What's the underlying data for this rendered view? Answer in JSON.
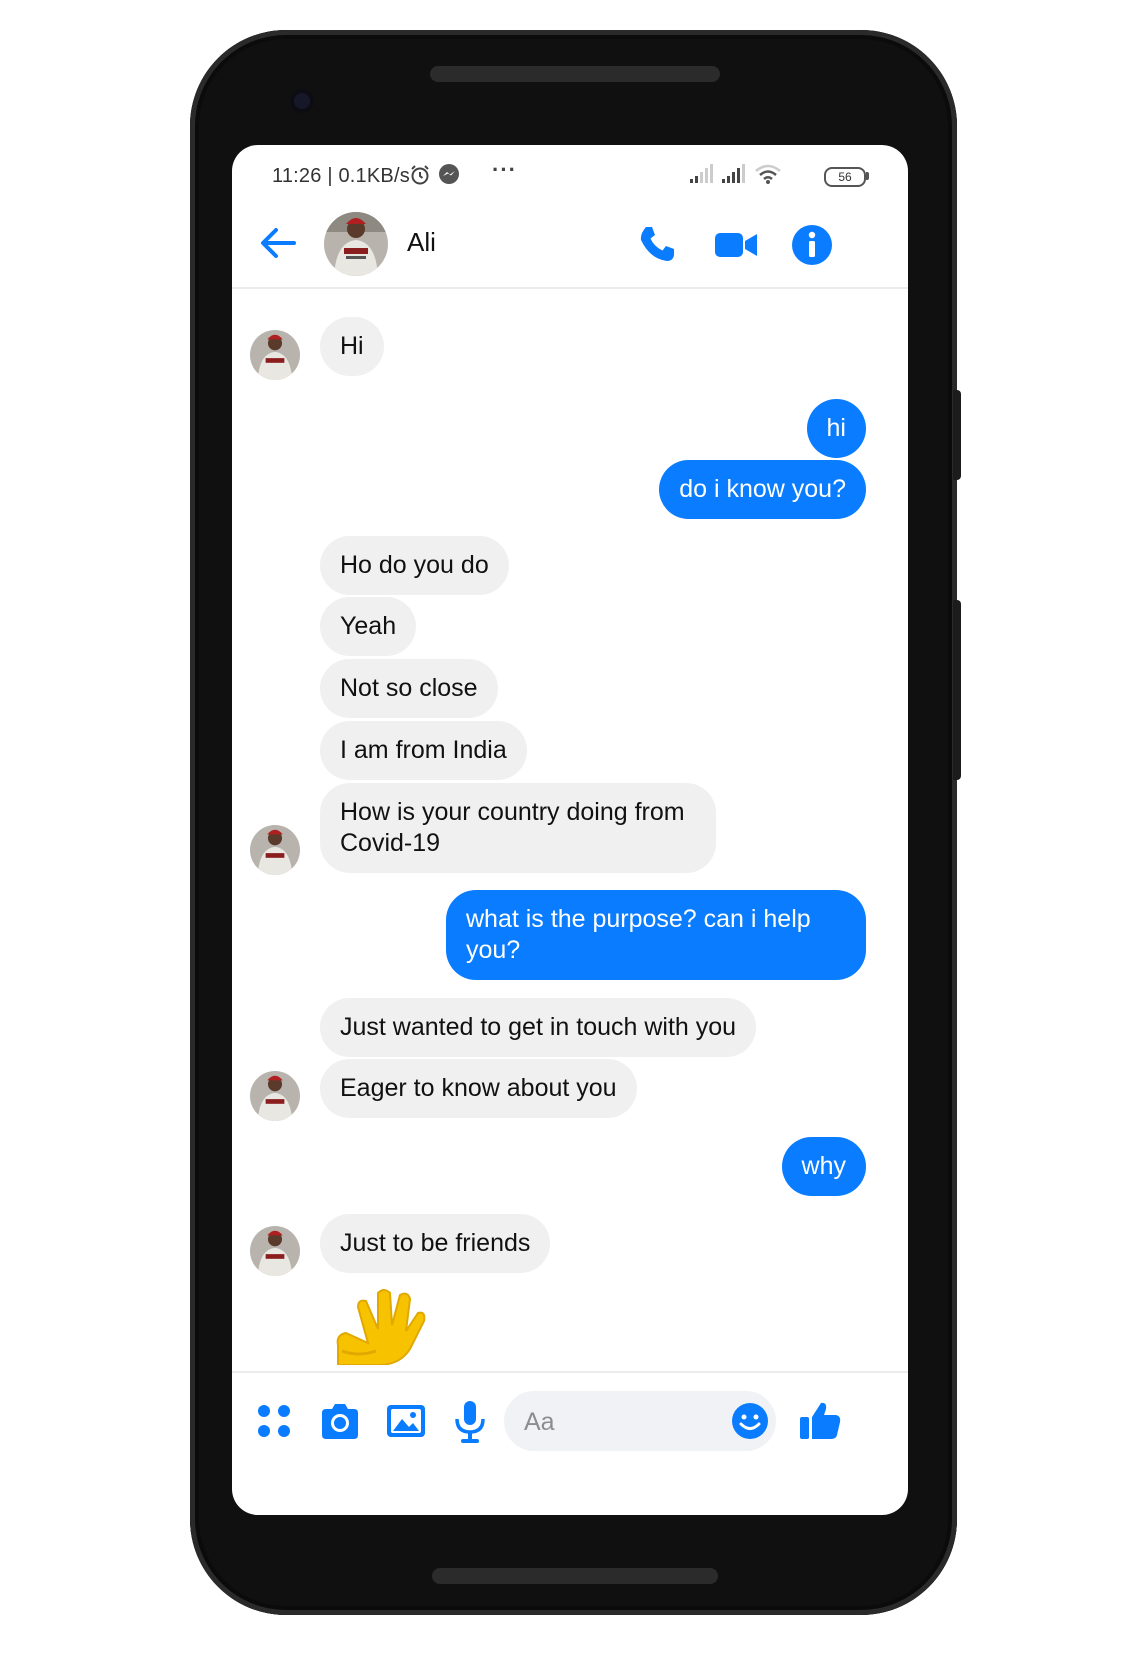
{
  "status_bar": {
    "time": "11:26 | 0.1KB/s",
    "dots": "···",
    "battery": "56"
  },
  "header": {
    "contact_name": "Ali",
    "accent_color": "#0a7cff"
  },
  "messages": [
    {
      "from": "them",
      "text": "Hi"
    },
    {
      "from": "me",
      "text": "hi"
    },
    {
      "from": "me",
      "text": "do i know you?"
    },
    {
      "from": "them",
      "text": "Ho do you do"
    },
    {
      "from": "them",
      "text": "Yeah"
    },
    {
      "from": "them",
      "text": "Not so close"
    },
    {
      "from": "them",
      "text": "I am from India"
    },
    {
      "from": "them",
      "text": "How is your country doing from Covid-19"
    },
    {
      "from": "me",
      "text": "what is the purpose? can i help you?"
    },
    {
      "from": "them",
      "text": "Just wanted to get in touch with you"
    },
    {
      "from": "them",
      "text": "Eager to know about you"
    },
    {
      "from": "me",
      "text": "why"
    },
    {
      "from": "them",
      "text": "Just to be friends"
    }
  ],
  "composer": {
    "placeholder": "Aa"
  },
  "colors": {
    "outgoing_bubble": "#0a7cff",
    "incoming_bubble": "#f0f0f0",
    "icon_blue": "#0a7cff"
  }
}
